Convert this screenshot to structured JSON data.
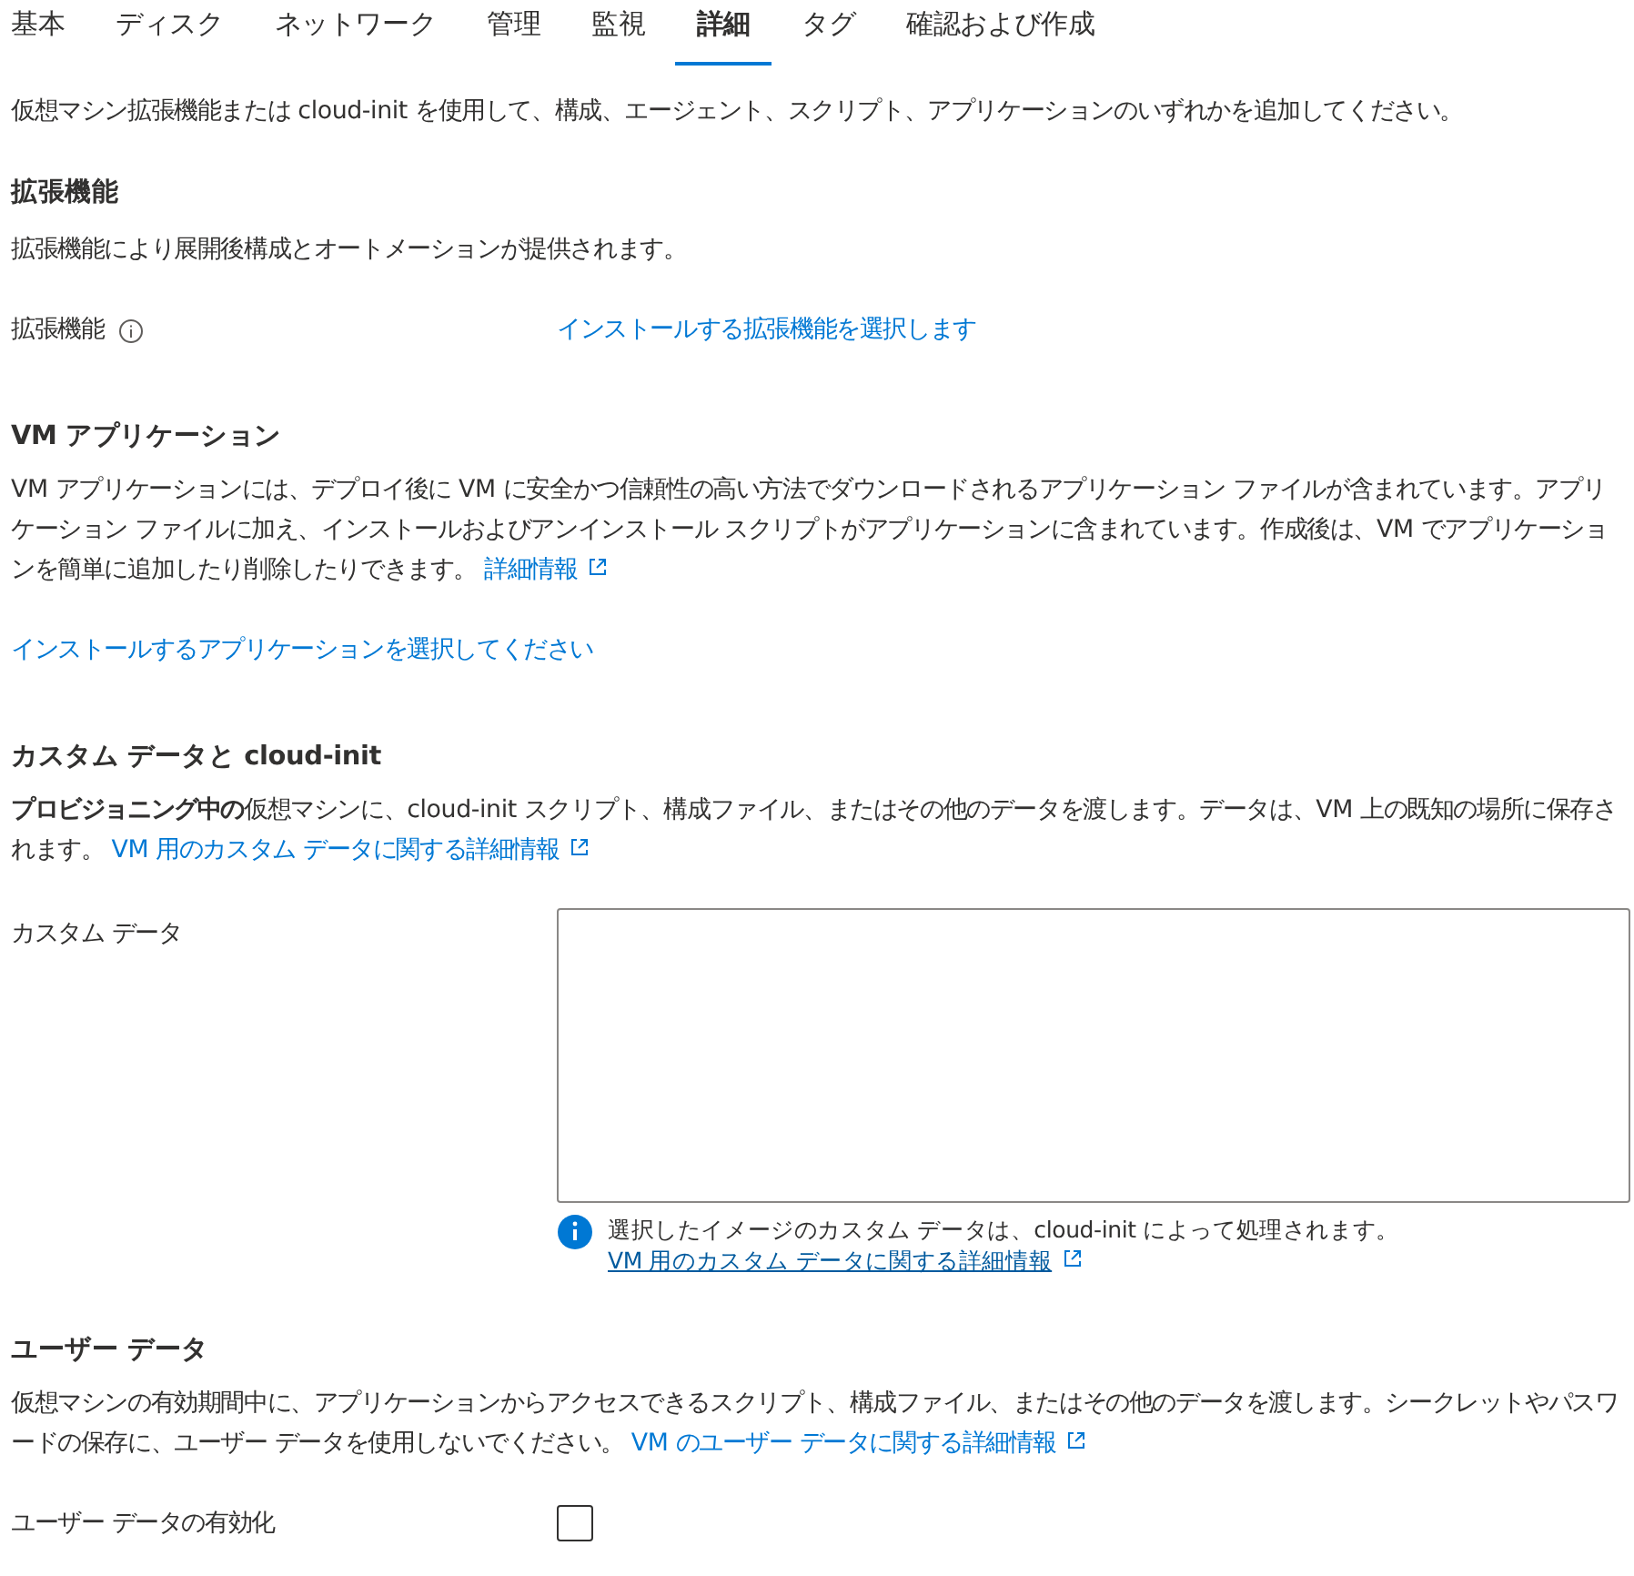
{
  "tabs": [
    {
      "label": "基本",
      "selected": false
    },
    {
      "label": "ディスク",
      "selected": false
    },
    {
      "label": "ネットワーク",
      "selected": false
    },
    {
      "label": "管理",
      "selected": false
    },
    {
      "label": "監視",
      "selected": false
    },
    {
      "label": "詳細",
      "selected": true
    },
    {
      "label": "タグ",
      "selected": false
    },
    {
      "label": "確認および作成",
      "selected": false
    }
  ],
  "intro": "仮想マシン拡張機能または cloud-init を使用して、構成、エージェント、スクリプト、アプリケーションのいずれかを追加してください。",
  "extensions": {
    "heading": "拡張機能",
    "description": "拡張機能により展開後構成とオートメーションが提供されます。",
    "field_label": "拡張機能",
    "select_link": "インストールする拡張機能を選択します"
  },
  "vm_applications": {
    "heading": "VM アプリケーション",
    "text": "VM アプリケーションには、デプロイ後に VM に安全かつ信頼性の高い方法でダウンロードされるアプリケーション ファイルが含まれています。アプリケーション ファイルに加え、インストールおよびアンインストール スクリプトがアプリケーションに含まれています。作成後は、VM でアプリケーションを簡単に追加したり削除したりできます。",
    "link": "詳細情報",
    "select_link": "インストールするアプリケーションを選択してください"
  },
  "custom_data": {
    "heading": "カスタム データと cloud-init",
    "text": "**プロビジョニング中の**仮想マシンに、cloud-init スクリプト、構成ファイル、またはその他のデータを渡します。データは、VM 上の既知の場所に保存されます。",
    "link": "VM 用のカスタム データに関する詳細情報",
    "field_label": "カスタム データ",
    "info_text": "選択したイメージのカスタム データは、cloud-init によって処理されます。",
    "info_link": "VM 用のカスタム データに関する詳細情報"
  },
  "user_data": {
    "heading": "ユーザー データ",
    "text": "仮想マシンの有効期間中に、アプリケーションからアクセスできるスクリプト、構成ファイル、またはその他のデータを渡します。シークレットやパスワードの保存に、ユーザー データを使用しないでください。",
    "link": "VM のユーザー データに関する詳細情報",
    "checkbox_label": "ユーザー データの有効化",
    "checked": false
  }
}
